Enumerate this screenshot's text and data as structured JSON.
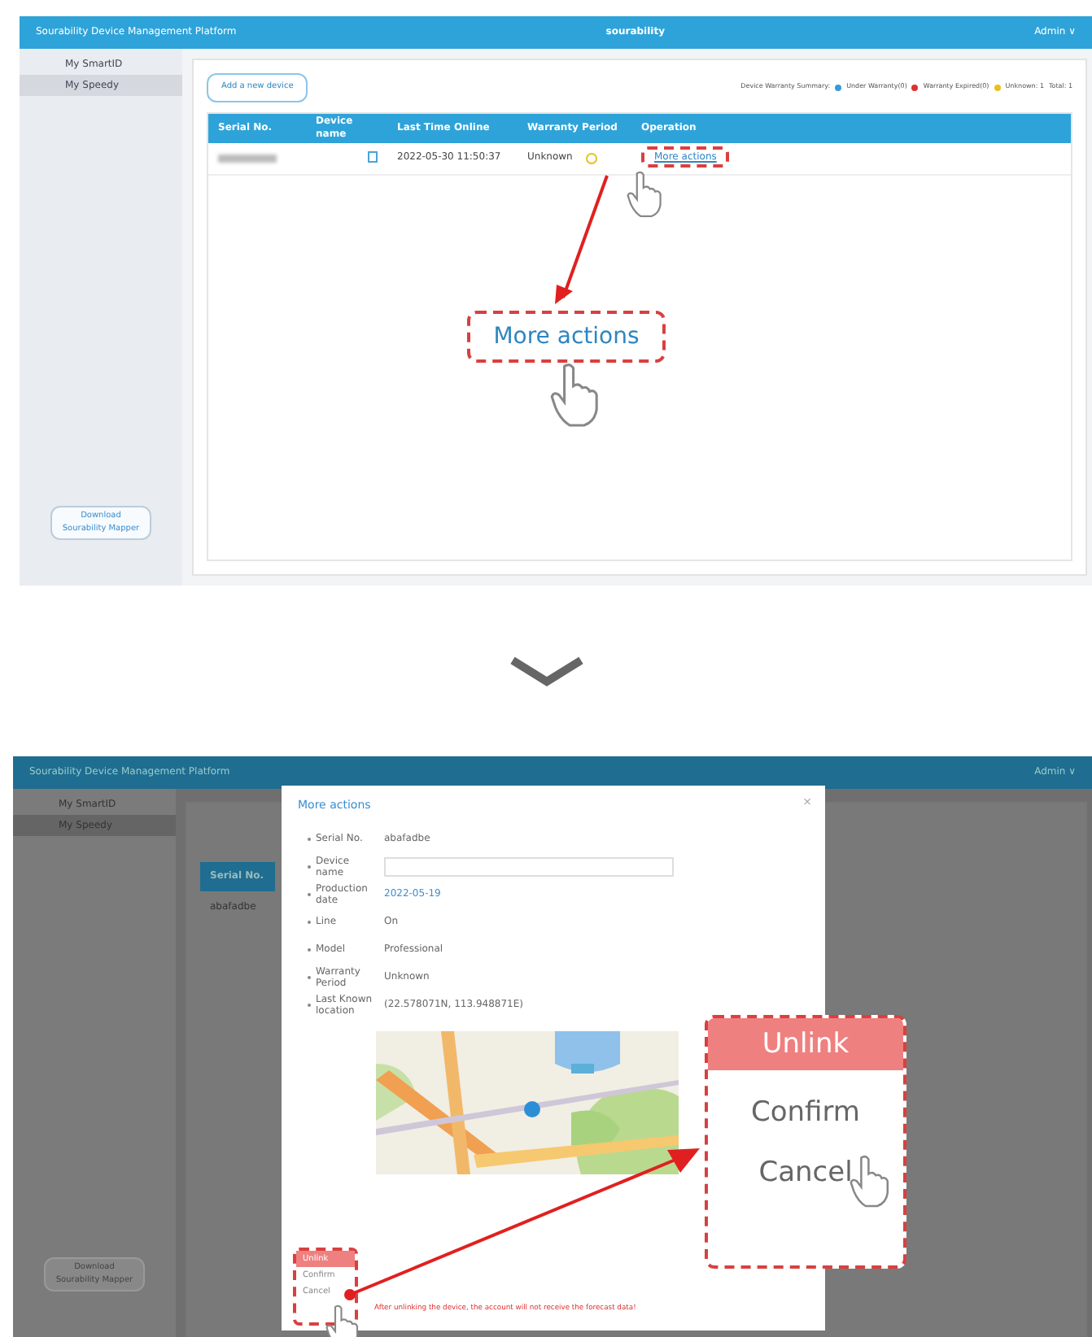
{
  "step_1": {
    "header": {
      "title": "Sourability Device Management Platform",
      "brand": "sourability",
      "user": "Admin ∨"
    },
    "sidebar": {
      "items": [
        {
          "label": "My SmartID",
          "selected": false
        },
        {
          "label": "My Speedy",
          "selected": true
        }
      ],
      "download_button": [
        "Download",
        "Sourability Mapper"
      ]
    },
    "toolbar": {
      "add_button": "Add a new device",
      "summary": [
        {
          "label": "Device Warranty Summary:"
        },
        {
          "label": "Under Warranty(0)",
          "color": "#3a9ad9"
        },
        {
          "label": "Warranty Expired(0)",
          "color": "#e03030"
        },
        {
          "label": "Unknown: 1",
          "color": "#e8c020"
        },
        {
          "label": "Total: 1"
        }
      ]
    },
    "table": {
      "columns": [
        "Serial No.",
        "Device name",
        "Last Time Online",
        "Warranty Period",
        "Operation"
      ],
      "rows": [
        {
          "serial": {
            "kind": "redacted"
          },
          "last_online": "2022-05-30 11:50:37",
          "warranty": "Unknown",
          "operation": "More actions"
        }
      ]
    },
    "callout": "More actions"
  },
  "step_2": {
    "header": {
      "title": "Sourability Device Management Platform",
      "user": "Admin ∨"
    },
    "sidebar": {
      "items": [
        {
          "label": "My SmartID",
          "selected": false
        },
        {
          "label": "My Speedy",
          "selected": true
        }
      ],
      "download_button": [
        "Download",
        "Sourability Mapper"
      ]
    },
    "table": {
      "column": "Serial No.",
      "row": "abafadbe"
    },
    "dialog": {
      "title": "More actions",
      "close": "×",
      "fields": [
        {
          "label": "Serial No.",
          "kind": "text",
          "value": "abafadbe"
        },
        {
          "label": "Device name",
          "kind": "input"
        },
        {
          "label": "Production date",
          "kind": "link",
          "value": "2022-05-19"
        },
        {
          "label": "Line",
          "kind": "text",
          "value": "On"
        },
        {
          "label": "Model",
          "kind": "text",
          "value": "Professional"
        },
        {
          "label": "Warranty Period",
          "kind": "text",
          "value": "Unknown"
        },
        {
          "label": "Last Known location",
          "kind": "text",
          "value": "(22.578071N, 113.948871E)"
        }
      ],
      "menu": {
        "header": "Unlink",
        "items": [
          "Confirm",
          "Cancel"
        ]
      },
      "warning": "After unlinking the device, the account will not receive the forecast data!"
    },
    "callout": {
      "header": "Unlink",
      "items": [
        "Confirm",
        "Cancel"
      ]
    }
  }
}
